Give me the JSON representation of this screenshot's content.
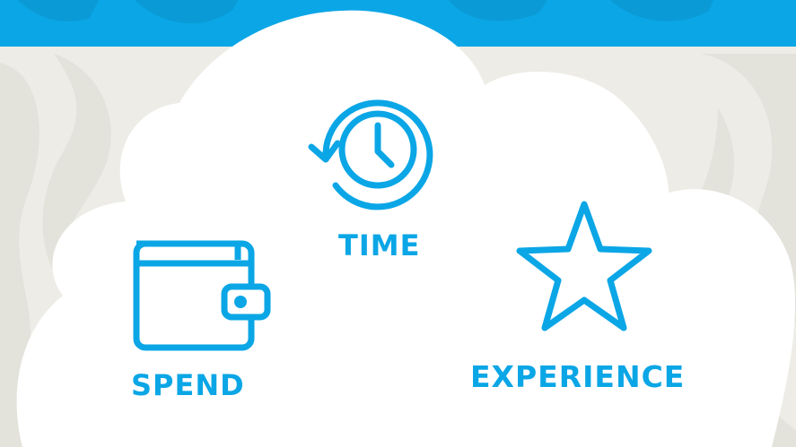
{
  "items": [
    {
      "label": "TIME",
      "icon": "clock-history-icon"
    },
    {
      "label": "SPEND",
      "icon": "wallet-icon"
    },
    {
      "label": "EXPERIENCE",
      "icon": "star-icon"
    }
  ],
  "colors": {
    "accent": "#0ba6e6",
    "banner": "#0ba6e6",
    "cloud": "#ffffff",
    "background": "#edece6",
    "pattern": "#e3e2db"
  }
}
